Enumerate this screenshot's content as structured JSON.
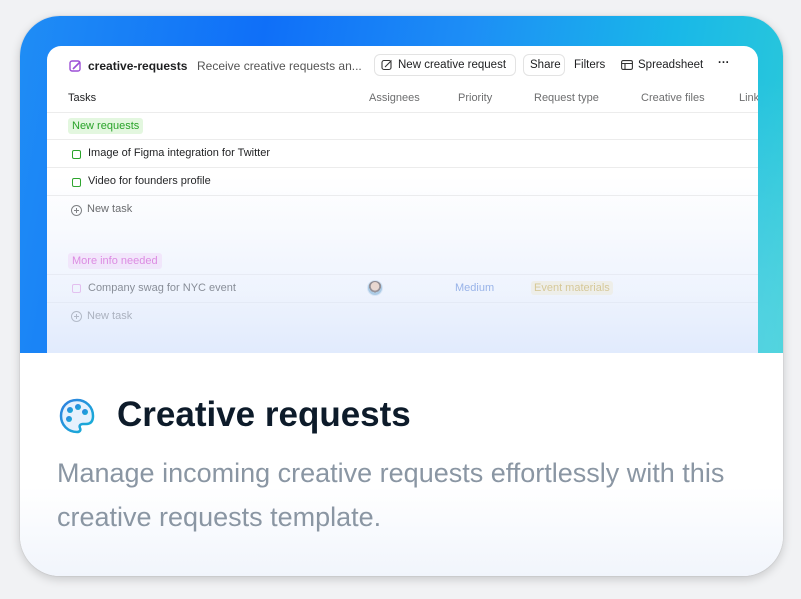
{
  "toolbar": {
    "project_name": "creative-requests",
    "description": "Receive creative requests an...",
    "new_request_label": "New creative request",
    "share_label": "Share",
    "filters_label": "Filters",
    "spreadsheet_label": "Spreadsheet",
    "more_label": "···"
  },
  "columns": [
    "Tasks",
    "Assignees",
    "Priority",
    "Request type",
    "Creative files",
    "Link"
  ],
  "sections": [
    {
      "name": "New requests",
      "badge_color": "#29a329",
      "badge_bg": "#e3f7df",
      "tasks": [
        {
          "name": "Image of Figma integration for Twitter"
        },
        {
          "name": "Video for founders profile"
        }
      ],
      "new_task_label": "New task"
    },
    {
      "name": "More info needed",
      "badge_color": "#d94ad1",
      "badge_bg": "#fce4fa",
      "tasks": [
        {
          "name": "Company swag for NYC event",
          "priority": "Medium",
          "request_type": "Event materials"
        }
      ],
      "new_task_label": "New task"
    }
  ],
  "footer": {
    "icon": "palette-icon",
    "title": "Creative requests",
    "description": "Manage incoming creative requests effortlessly with this creative requests template."
  },
  "colors": {
    "accent": "#1f8df5",
    "priority_medium": "#4573d2",
    "tag_yellow": "#c9a227"
  }
}
